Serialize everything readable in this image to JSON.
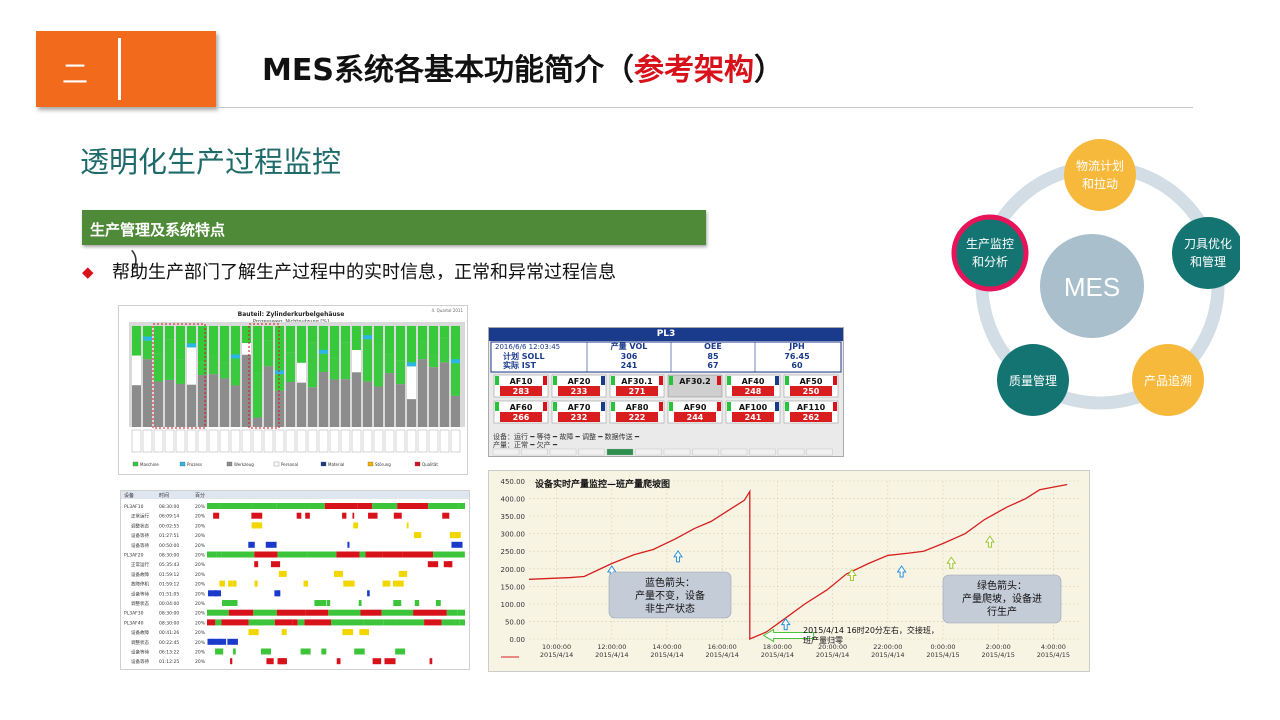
{
  "header": {
    "section_number": "二",
    "title_prefix": "MES系统各基本功能简介（",
    "title_highlight": "参考架构",
    "title_suffix": "）",
    "accent_color": "#f26b1d",
    "highlight_color": "#d8121a"
  },
  "subtitle": "透明化生产过程监控",
  "section_bar": {
    "label": "生产管理及系统特点",
    "color": "#4e8a37"
  },
  "stray_glyph": "）",
  "bullet": {
    "marker": "◆",
    "text": "帮助生产部门了解生产过程中的实时信息，正常和异常过程信息"
  },
  "cycle": {
    "center": "MES",
    "nodes": [
      "物流计划和拉动",
      "刀具优化和管理",
      "产品追溯",
      "质量管理",
      "生产监控和分析"
    ],
    "active": "生产监控和分析"
  },
  "stacked_chart": {
    "title": "Bauteil: Zylinderkurbelgehäuse",
    "subtitle": "Prozessweg: Nichtnutzung [%]",
    "corner_note": "4. Quartal 2011",
    "legend": [
      "Maschine",
      "Prozess",
      "Werkzeug",
      "Personal",
      "Material",
      "Störung",
      "Qualität"
    ]
  },
  "pl3_board": {
    "title": "PL3",
    "datetime": "2016/6/6 12:03:45",
    "headers": [
      "产量 VOL",
      "OEE",
      "JPH"
    ],
    "rows": [
      {
        "label": "计划 SOLL",
        "values": [
          "306",
          "85",
          "76.45"
        ]
      },
      {
        "label": "实际 IST",
        "values": [
          "241",
          "67",
          "60"
        ]
      }
    ],
    "stations": [
      {
        "name": "AF10",
        "value": "283"
      },
      {
        "name": "AF20",
        "value": "233"
      },
      {
        "name": "AF30.1",
        "value": "271"
      },
      {
        "name": "AF30.2",
        "value": ""
      },
      {
        "name": "AF40",
        "value": "248"
      },
      {
        "name": "AF50",
        "value": "250"
      },
      {
        "name": "AF60",
        "value": "266"
      },
      {
        "name": "AF70",
        "value": "232"
      },
      {
        "name": "AF80",
        "value": "222"
      },
      {
        "name": "AF90",
        "value": "244"
      },
      {
        "name": "AF100",
        "value": "241"
      },
      {
        "name": "AF110",
        "value": "262"
      }
    ],
    "legend_line1": "设备：运行 ━ 等待 ━ 故障 ━ 调整 ━ 数据传送 ━",
    "legend_line2": "产量：正常 ━ 欠产 ━"
  },
  "gantt": {
    "col_device": "设备",
    "col_time": "时间",
    "col_pct": "百分",
    "rows": [
      {
        "label": "PL3AF10",
        "time": "08:30:00",
        "pct": "20%"
      },
      {
        "label": "正常运行",
        "time": "06:09:14",
        "pct": "20%"
      },
      {
        "label": "调整状态",
        "time": "00:02:55",
        "pct": "20%"
      },
      {
        "label": "设备等待",
        "time": "01:27:51",
        "pct": "20%"
      },
      {
        "label": "设备等待",
        "time": "00:50:00",
        "pct": "20%"
      },
      {
        "label": "PL3AF20",
        "time": "08:30:00",
        "pct": "20%"
      },
      {
        "label": "正常运行",
        "time": "05:35:43",
        "pct": "20%"
      },
      {
        "label": "设备故障",
        "time": "01:59:12",
        "pct": "20%"
      },
      {
        "label": "故障停机",
        "time": "01:59:12",
        "pct": "20%"
      },
      {
        "label": "设备等待",
        "time": "01:51:05",
        "pct": "20%"
      },
      {
        "label": "调整状态",
        "time": "00:04:00",
        "pct": "20%"
      },
      {
        "label": "PL3AF30",
        "time": "08:30:00",
        "pct": "20%"
      },
      {
        "label": "PL3AF40",
        "time": "08:30:00",
        "pct": "20%"
      },
      {
        "label": "设备故障",
        "time": "00:41:26",
        "pct": "20%"
      },
      {
        "label": "调整状态",
        "time": "00:22:45",
        "pct": "20%"
      },
      {
        "label": "设备等待",
        "time": "06:13:22",
        "pct": "20%"
      },
      {
        "label": "设备等待",
        "time": "01:12:25",
        "pct": "20%"
      }
    ]
  },
  "chart_data": {
    "type": "line",
    "title": "设备实时产量监控—班产量爬坡图",
    "ylim": [
      0,
      450
    ],
    "yticks": [
      "0.00",
      "50.00",
      "100.00",
      "150.00",
      "200.00",
      "250.00",
      "300.00",
      "350.00",
      "400.00",
      "450.00"
    ],
    "xticks": [
      [
        "10:00:00",
        "2015/4/14"
      ],
      [
        "12:00:00",
        "2015/4/14"
      ],
      [
        "14:00:00",
        "2015/4/14"
      ],
      [
        "16:00:00",
        "2015/4/14"
      ],
      [
        "18:00:00",
        "2015/4/14"
      ],
      [
        "20:00:00",
        "2015/4/14"
      ],
      [
        "22:00:00",
        "2015/4/14"
      ],
      [
        "0:00:00",
        "2015/4/15"
      ],
      [
        "2:00:00",
        "2015/4/15"
      ],
      [
        "4:00:00",
        "2015/4/15"
      ]
    ],
    "series": [
      {
        "color": "#d81e1e",
        "points": [
          [
            9.0,
            170
          ],
          [
            10.5,
            175
          ],
          [
            11.0,
            178
          ],
          [
            12.0,
            215
          ],
          [
            12.8,
            240
          ],
          [
            13.5,
            255
          ],
          [
            14.3,
            285
          ],
          [
            15.0,
            315
          ],
          [
            15.6,
            335
          ],
          [
            16.3,
            370
          ],
          [
            16.8,
            395
          ],
          [
            17.0,
            420
          ],
          [
            17.0,
            0
          ],
          [
            17.6,
            20
          ],
          [
            18.3,
            60
          ],
          [
            19.0,
            100
          ],
          [
            19.8,
            140
          ],
          [
            20.5,
            185
          ],
          [
            21.3,
            215
          ],
          [
            22.0,
            238
          ],
          [
            22.8,
            245
          ],
          [
            23.3,
            250
          ],
          [
            24.0,
            272
          ],
          [
            24.8,
            300
          ],
          [
            25.5,
            340
          ],
          [
            26.3,
            375
          ],
          [
            27.0,
            400
          ],
          [
            27.5,
            425
          ],
          [
            28.5,
            440
          ]
        ]
      }
    ],
    "annotations": {
      "blue_box": [
        "蓝色箭头：",
        "产量不变，设备",
        "非生产状态"
      ],
      "green_box": [
        "绿色箭头：",
        "产量爬坡，设备进",
        "行生产"
      ],
      "shift_note": [
        "2015/4/14 16时20分左右，交接班，",
        "班产量归零"
      ]
    }
  }
}
